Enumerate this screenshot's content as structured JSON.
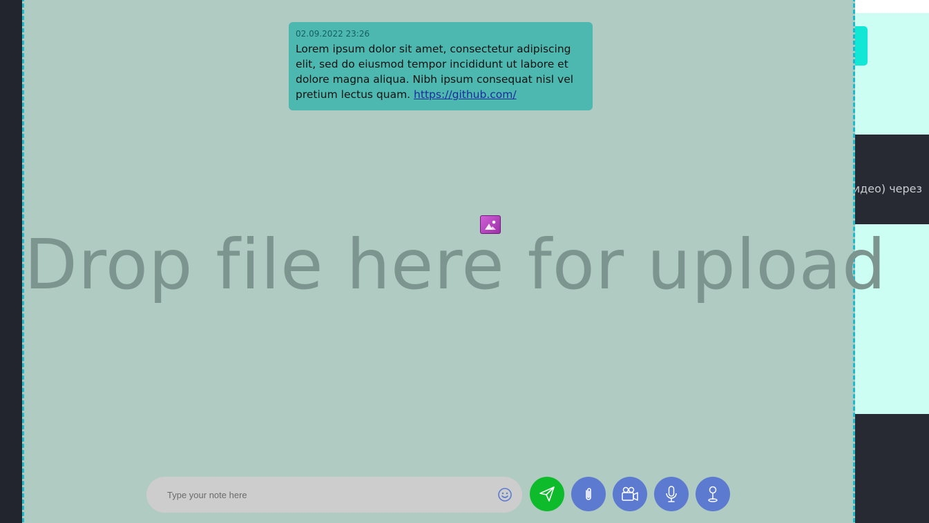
{
  "message": {
    "timestamp": "02.09.2022 23:26",
    "text": "Lorem ipsum dolor sit amet, consectetur adipiscing elit, sed do eiusmod tempor incididunt ut labore et dolore magna aliqua. Nibh ipsum consequat nisl vel pretium lectus quam.",
    "link": "https://github.com/"
  },
  "drop_zone": {
    "label": "Drop file here for upload",
    "file_icon": "image-file-icon"
  },
  "composer": {
    "placeholder": "Type your note here",
    "value": "",
    "emoji_icon": "smiley-icon"
  },
  "actions": {
    "send_icon": "paper-plane-icon",
    "attach_icon": "paperclip-icon",
    "video_icon": "video-camera-icon",
    "mic_icon": "microphone-icon",
    "geo_icon": "map-pin-icon"
  },
  "background": {
    "partial_text": "идео) через"
  },
  "colors": {
    "overlay": "#afcbc2",
    "overlay_border": "#1ab9cc",
    "message_bg": "#4db8b0",
    "send": "#0dbb2b",
    "action": "#5b7ad0",
    "mint": "#ccfef3",
    "dark": "#272a33"
  }
}
